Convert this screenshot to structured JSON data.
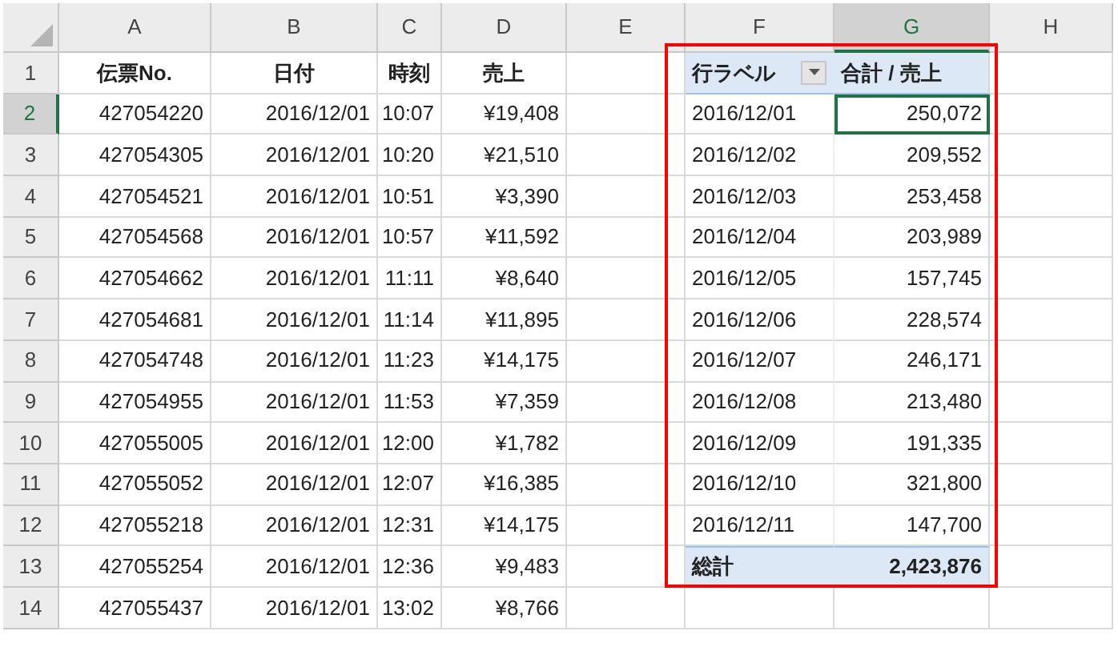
{
  "column_headers": [
    {
      "label": "A",
      "selected": false
    },
    {
      "label": "B",
      "selected": false
    },
    {
      "label": "C",
      "selected": false
    },
    {
      "label": "D",
      "selected": false
    },
    {
      "label": "E",
      "selected": false
    },
    {
      "label": "F",
      "selected": false
    },
    {
      "label": "G",
      "selected": true
    },
    {
      "label": "H",
      "selected": false
    }
  ],
  "row_headers": [
    {
      "label": "1",
      "selected": false
    },
    {
      "label": "2",
      "selected": true
    },
    {
      "label": "3",
      "selected": false
    },
    {
      "label": "4",
      "selected": false
    },
    {
      "label": "5",
      "selected": false
    },
    {
      "label": "6",
      "selected": false
    },
    {
      "label": "7",
      "selected": false
    },
    {
      "label": "8",
      "selected": false
    },
    {
      "label": "9",
      "selected": false
    },
    {
      "label": "10",
      "selected": false
    },
    {
      "label": "11",
      "selected": false
    },
    {
      "label": "12",
      "selected": false
    },
    {
      "label": "13",
      "selected": false
    },
    {
      "label": "14",
      "selected": false
    }
  ],
  "data_table": {
    "columns": [
      "伝票No.",
      "日付",
      "時刻",
      "売上"
    ],
    "rows": [
      [
        "427054220",
        "2016/12/01",
        "10:07",
        "¥19,408"
      ],
      [
        "427054305",
        "2016/12/01",
        "10:20",
        "¥21,510"
      ],
      [
        "427054521",
        "2016/12/01",
        "10:51",
        "¥3,390"
      ],
      [
        "427054568",
        "2016/12/01",
        "10:57",
        "¥11,592"
      ],
      [
        "427054662",
        "2016/12/01",
        "11:11",
        "¥8,640"
      ],
      [
        "427054681",
        "2016/12/01",
        "11:14",
        "¥11,895"
      ],
      [
        "427054748",
        "2016/12/01",
        "11:23",
        "¥14,175"
      ],
      [
        "427054955",
        "2016/12/01",
        "11:53",
        "¥7,359"
      ],
      [
        "427055005",
        "2016/12/01",
        "12:00",
        "¥1,782"
      ],
      [
        "427055052",
        "2016/12/01",
        "12:07",
        "¥16,385"
      ],
      [
        "427055218",
        "2016/12/01",
        "12:31",
        "¥14,175"
      ],
      [
        "427055254",
        "2016/12/01",
        "12:36",
        "¥9,483"
      ],
      [
        "427055437",
        "2016/12/01",
        "13:02",
        "¥8,766"
      ]
    ]
  },
  "pivot_table": {
    "row_label": "行ラベル",
    "value_label": "合計 / 売上",
    "rows": [
      {
        "label": "2016/12/01",
        "value": "250,072",
        "selected": true
      },
      {
        "label": "2016/12/02",
        "value": "209,552",
        "selected": false
      },
      {
        "label": "2016/12/03",
        "value": "253,458",
        "selected": false
      },
      {
        "label": "2016/12/04",
        "value": "203,989",
        "selected": false
      },
      {
        "label": "2016/12/05",
        "value": "157,745",
        "selected": false
      },
      {
        "label": "2016/12/06",
        "value": "228,574",
        "selected": false
      },
      {
        "label": "2016/12/07",
        "value": "246,171",
        "selected": false
      },
      {
        "label": "2016/12/08",
        "value": "213,480",
        "selected": false
      },
      {
        "label": "2016/12/09",
        "value": "191,335",
        "selected": false
      },
      {
        "label": "2016/12/10",
        "value": "321,800",
        "selected": false
      },
      {
        "label": "2016/12/11",
        "value": "147,700",
        "selected": false
      }
    ],
    "total": {
      "label": "総計",
      "value": "2,423,876"
    }
  }
}
